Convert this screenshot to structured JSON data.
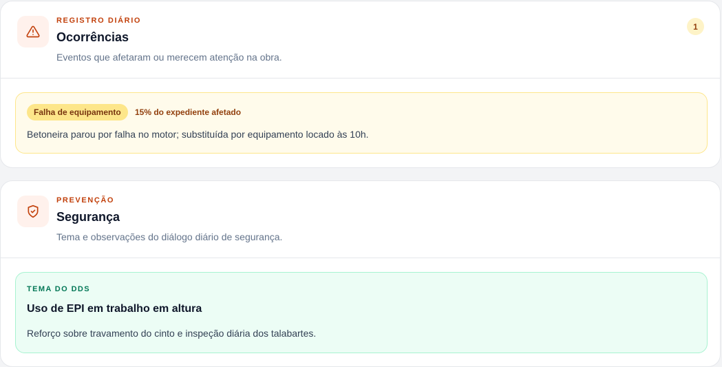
{
  "occurrences": {
    "kicker": "REGISTRO DIÁRIO",
    "title": "Ocorrências",
    "subtitle": "Eventos que afetaram ou merecem atenção na obra.",
    "count": "1",
    "icon": "warning-triangle-icon",
    "items": [
      {
        "type": "Falha de equipamento",
        "impact": "15% do expediente afetado",
        "description": "Betoneira parou por falha no motor; substituída por equipamento locado às 10h."
      }
    ]
  },
  "safety": {
    "kicker": "PREVENÇÃO",
    "title": "Segurança",
    "subtitle": "Tema e observações do diálogo diário de segurança.",
    "icon": "shield-check-icon",
    "dds": {
      "label": "TEMA DO DDS",
      "theme": "Uso de EPI em trabalho em altura",
      "notes": "Reforço sobre travamento do cinto e inspeção diária dos talabartes."
    }
  },
  "colors": {
    "accent": "#c2410c",
    "warning_bg": "#fffbeb",
    "success_bg": "#ecfdf5"
  }
}
